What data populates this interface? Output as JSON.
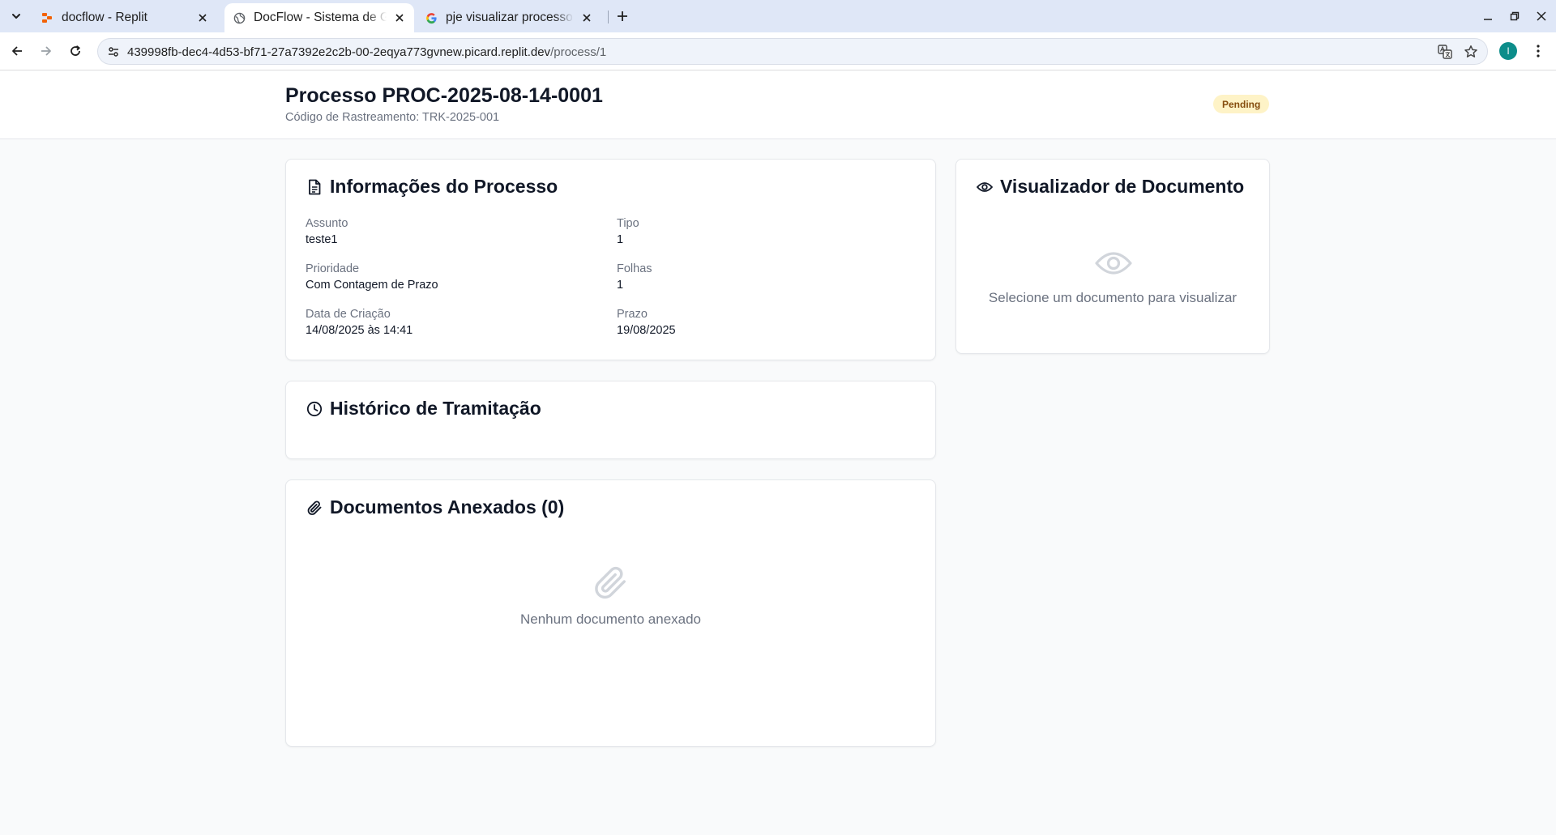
{
  "browser": {
    "tabs": [
      {
        "title": "docflow - Replit",
        "icon": "replit-icon"
      },
      {
        "title": "DocFlow - Sistema de Gestão",
        "icon": "globe-icon"
      },
      {
        "title": "pje visualizar processo - Pesquisa Google",
        "icon": "google-icon"
      }
    ],
    "url_host": "439998fb-dec4-4d53-bf71-27a7392e2c2b-00-2eqya773gvnew.picard.replit.dev",
    "url_path": "/process/1",
    "profile_initial": "I"
  },
  "header": {
    "title": "Processo PROC-2025-08-14-0001",
    "tracking": "Código de Rastreamento: TRK-2025-001",
    "status": "Pending"
  },
  "info": {
    "title": "Informações do Processo",
    "fields": {
      "assunto": {
        "label": "Assunto",
        "value": "teste1"
      },
      "tipo": {
        "label": "Tipo",
        "value": "1"
      },
      "prioridade": {
        "label": "Prioridade",
        "value": "Com Contagem de Prazo"
      },
      "folhas": {
        "label": "Folhas",
        "value": "1"
      },
      "data_criacao": {
        "label": "Data de Criação",
        "value": "14/08/2025 às 14:41"
      },
      "prazo": {
        "label": "Prazo",
        "value": "19/08/2025"
      }
    }
  },
  "viewer": {
    "title": "Visualizador de Documento",
    "empty": "Selecione um documento para visualizar"
  },
  "history": {
    "title": "Histórico de Tramitação"
  },
  "documents": {
    "title": "Documentos Anexados (0)",
    "empty": "Nenhum documento anexado"
  },
  "colors": {
    "badge_bg": "#fef3c7",
    "badge_text": "#854d0e",
    "profile": "#0c8d8a"
  }
}
